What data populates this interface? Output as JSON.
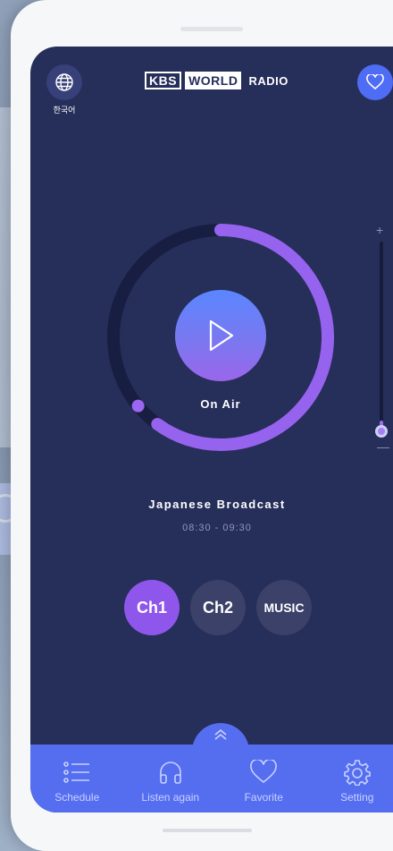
{
  "app": {
    "logo": {
      "kbs": "KBS",
      "world": "WORLD",
      "radio": "RADIO"
    },
    "language_label": "한국어"
  },
  "icons": {
    "language": "globe-icon",
    "favorite_top": "heart-icon",
    "play": "play-icon",
    "expand": "chevron-up-icon",
    "schedule": "list-icon",
    "listen_again": "headphones-icon",
    "favorite": "heart-icon",
    "setting": "gear-icon"
  },
  "player": {
    "status": "On Air",
    "progress": 0.6,
    "volume": 0.05
  },
  "program": {
    "title": "Japanese Broadcast",
    "time": "08:30 - 09:30"
  },
  "volume": {
    "plus": "+",
    "minus": "—"
  },
  "channels": [
    {
      "label": "Ch1",
      "active": true
    },
    {
      "label": "Ch2",
      "active": false
    },
    {
      "label": "MUSIC",
      "active": false
    }
  ],
  "bottom_nav": [
    {
      "label": "Schedule"
    },
    {
      "label": "Listen again"
    },
    {
      "label": "Favorite"
    },
    {
      "label": "Setting"
    }
  ],
  "colors": {
    "screen_bg": "#262e5a",
    "accent_blue": "#556ef0",
    "accent_purple": "#8f56ec",
    "ring_track": "#181e42"
  }
}
